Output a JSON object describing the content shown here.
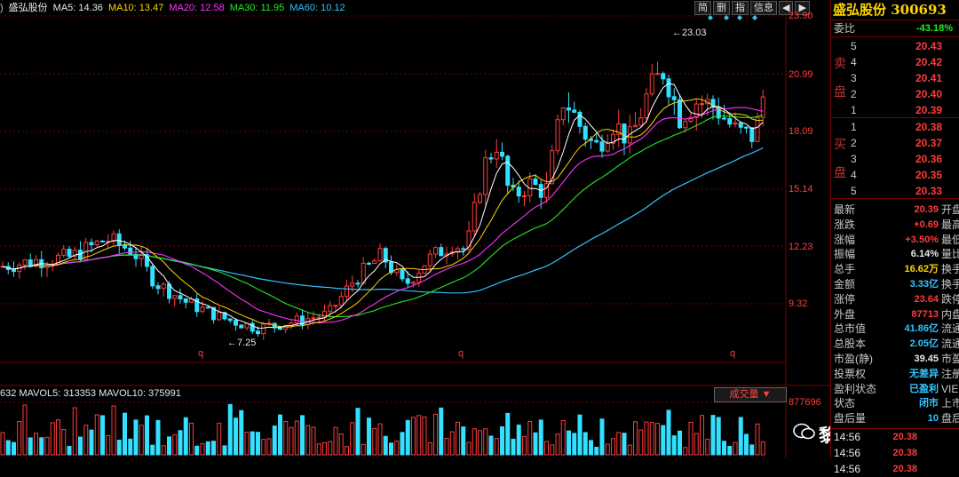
{
  "header": {
    "left_fragment": ")",
    "stock_name": "盛弘股份",
    "ma5": "MA5: 14.36",
    "ma10": "MA10: 13.47",
    "ma20": "MA20: 12.58",
    "ma30": "MA30: 11.95",
    "ma60": "MA60: 10.12",
    "buttons": [
      "简",
      "删",
      "指",
      "信息",
      "◀",
      "▶"
    ]
  },
  "price_axis": [
    "23.90",
    "20.99",
    "18.09",
    "15.14",
    "12.23",
    "9.32"
  ],
  "annotations": {
    "high": "23.03",
    "low": "7.25",
    "marker": "q"
  },
  "volume_header": {
    "text": "632  MAVOL5: 313353  MAVOL10: 375991",
    "button": "成交量",
    "axis_top": "877696"
  },
  "quote": {
    "title": "盛弘股份 300693",
    "weibi_label": "委比",
    "weibi_value": "-43.18%",
    "sell_label": [
      "卖",
      "盘"
    ],
    "buy_label": [
      "买",
      "盘"
    ],
    "sells": [
      {
        "lvl": "5",
        "price": "20.43"
      },
      {
        "lvl": "4",
        "price": "20.42"
      },
      {
        "lvl": "3",
        "price": "20.41"
      },
      {
        "lvl": "2",
        "price": "20.40"
      },
      {
        "lvl": "1",
        "price": "20.39"
      }
    ],
    "buys": [
      {
        "lvl": "1",
        "price": "20.38"
      },
      {
        "lvl": "2",
        "price": "20.37"
      },
      {
        "lvl": "3",
        "price": "20.36"
      },
      {
        "lvl": "4",
        "price": "20.35"
      },
      {
        "lvl": "5",
        "price": "20.33"
      }
    ],
    "stats": [
      {
        "label": "最新",
        "value": "20.39",
        "right": "开盘",
        "color": "red"
      },
      {
        "label": "涨跌",
        "value": "+0.69",
        "right": "最高",
        "color": "red"
      },
      {
        "label": "涨幅",
        "value": "+3.50%",
        "right": "最低",
        "color": "red"
      },
      {
        "label": "振幅",
        "value": "6.14%",
        "right": "量比",
        "color": "white"
      },
      {
        "label": "总手",
        "value": "16.62万",
        "right": "换手",
        "color": "yellow"
      },
      {
        "label": "金额",
        "value": "3.33亿",
        "right": "换手",
        "color": "cyan"
      },
      {
        "label": "涨停",
        "value": "23.64",
        "right": "跌停",
        "color": "red"
      },
      {
        "label": "外盘",
        "value": "87713",
        "right": "内盘",
        "color": "red"
      },
      {
        "label": "总市值",
        "value": "41.86亿",
        "right": "流通",
        "color": "cyan"
      },
      {
        "label": "总股本",
        "value": "2.05亿",
        "right": "流通",
        "color": "cyan"
      },
      {
        "label": "市盈(静)",
        "value": "39.45",
        "right": "市盈",
        "color": "white"
      },
      {
        "label": "投票权",
        "value": "无差异",
        "right": "注册",
        "color": "cyan"
      },
      {
        "label": "盈利状态",
        "value": "已盈利",
        "right": "VIE",
        "color": "cyan"
      },
      {
        "label": "状态",
        "value": "闭市",
        "right": "上市",
        "color": "cyan"
      },
      {
        "label": "盘后量",
        "value": "10",
        "right": "盘后",
        "color": "cyan"
      }
    ],
    "ticks": [
      {
        "time": "14:56",
        "price": "20.38"
      },
      {
        "time": "14:56",
        "price": "20.38"
      },
      {
        "time": "14:56",
        "price": "20.38"
      }
    ]
  },
  "watermark": "黎明投资",
  "colors": {
    "up": "#ff3b3b",
    "down": "#33e0ff",
    "ma5": "#ffffff",
    "ma10": "#ffd400",
    "ma20": "#ff33ff",
    "ma30": "#25e825",
    "ma60": "#33c4ff",
    "grid": "#7a0000"
  }
}
